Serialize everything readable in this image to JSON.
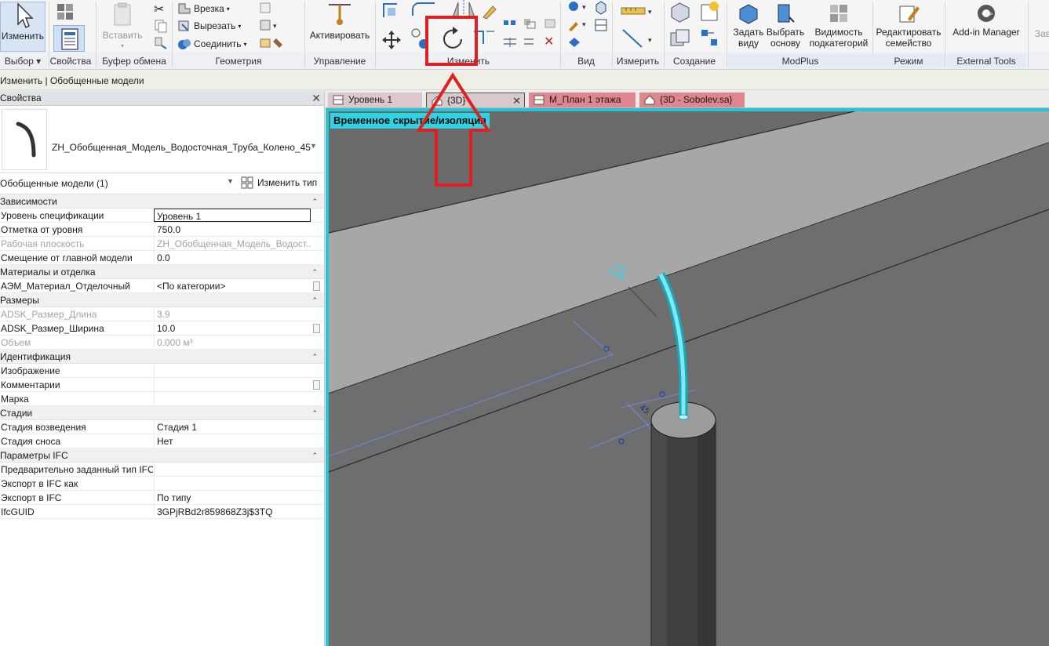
{
  "ribbon": {
    "modify": {
      "label": "Изменить"
    },
    "select_dropdown": "Выбор",
    "properties_group": "Свойства",
    "clipboard": {
      "paste": "Вставить",
      "group": "Буфер обмена"
    },
    "geometry": {
      "cope": "Врезка",
      "cut": "Вырезать",
      "join": "Соединить",
      "group": "Геометрия"
    },
    "control": {
      "activate": "Активировать",
      "group": "Управление"
    },
    "modify_group": "Изменить",
    "view_group": "Вид",
    "measure_group": "Измерить",
    "create_group": "Создание",
    "modplus": {
      "set_view": "Задать\nвиду",
      "pick_base": "Выбрать\nоснову",
      "subcat_vis": "Видимость\nподкатегорий",
      "group": "ModPlus"
    },
    "mode": {
      "edit_family": "Редактировать\nсемейство",
      "group": "Режим"
    },
    "external": {
      "addin_manager": "Add-in Manager",
      "group": "External Tools"
    },
    "cut_off_label": "Зав"
  },
  "context_bar": {
    "text": "Изменить | Обобщенные модели"
  },
  "properties": {
    "title": "Свойства",
    "type_name": "ZH_Обобщенная_Модель_Водосточная_Труба_Колено_45",
    "instance_filter": "Обобщенные модели (1)",
    "edit_type": "Изменить тип",
    "categories": [
      {
        "name": "Зависимости",
        "rows": [
          {
            "label": "Уровень спецификации",
            "value": "Уровень 1",
            "editing": true
          },
          {
            "label": "Отметка от уровня",
            "value": "750.0"
          },
          {
            "label": "Рабочая плоскость",
            "value": "ZH_Обобщенная_Модель_Водост...",
            "greyed": true
          },
          {
            "label": "Смещение от главной модели",
            "value": "0.0"
          }
        ]
      },
      {
        "name": "Материалы и отделка",
        "rows": [
          {
            "label": "АЭМ_Материал_Отделочный",
            "value": "<По категории>",
            "button": true
          }
        ]
      },
      {
        "name": "Размеры",
        "rows": [
          {
            "label": "ADSK_Размер_Длина",
            "value": "3.9",
            "greyed": true
          },
          {
            "label": "ADSK_Размер_Ширина",
            "value": "10.0",
            "button": true
          },
          {
            "label": "Объем",
            "value": "0.000 м³",
            "greyed": true
          }
        ]
      },
      {
        "name": "Идентификация",
        "rows": [
          {
            "label": "Изображение",
            "value": ""
          },
          {
            "label": "Комментарии",
            "value": "",
            "button": true
          },
          {
            "label": "Марка",
            "value": ""
          }
        ]
      },
      {
        "name": "Стадии",
        "rows": [
          {
            "label": "Стадия возведения",
            "value": "Стадия 1"
          },
          {
            "label": "Стадия сноса",
            "value": "Нет"
          }
        ]
      },
      {
        "name": "Параметры IFC",
        "rows": [
          {
            "label": "Предварительно заданный тип IFC",
            "value": ""
          },
          {
            "label": "Экспорт в IFC как",
            "value": ""
          },
          {
            "label": "Экспорт в IFC",
            "value": "По типу"
          },
          {
            "label": "IfcGUID",
            "value": "3GPjRBd2r859868Z3j$3TQ"
          }
        ]
      }
    ]
  },
  "tabs": [
    {
      "label": "Уровень 1",
      "bg": "#dcc8cc",
      "active": false,
      "icon": "floor-plan-icon"
    },
    {
      "label": "{3D}",
      "bg": "#d8c9cd",
      "active": true,
      "icon": "house-3d-icon",
      "close": "✕"
    },
    {
      "label": "М_План 1 этажа",
      "bg": "#e0868f",
      "active": false,
      "icon": "floor-plan-icon"
    },
    {
      "label": "{3D - Sobolev.sa}",
      "bg": "#e0868f",
      "active": false,
      "icon": "house-3d-icon"
    }
  ],
  "viewport": {
    "banner": "Временное скрытие/изоляция",
    "dimension_text": "45",
    "border_color": "#22c6d6"
  },
  "colors": {
    "annotation_red": "#e02020",
    "isolate_cyan": "#22c6d6"
  }
}
